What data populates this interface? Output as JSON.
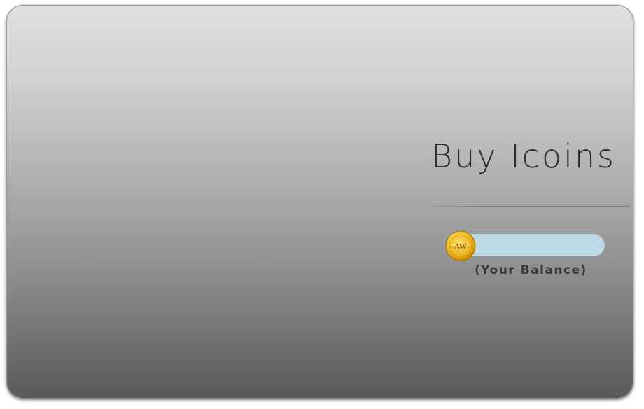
{
  "card": {
    "title": "Buy Icoins"
  },
  "balance": {
    "value": "",
    "label": "(Your Balance)",
    "coin_icon": "aw-coin-icon",
    "coin_text": "AW"
  },
  "colors": {
    "pill": "#bcd9e6",
    "coin_gold": "#f4c21a",
    "title_text": "#2b2b2b"
  }
}
